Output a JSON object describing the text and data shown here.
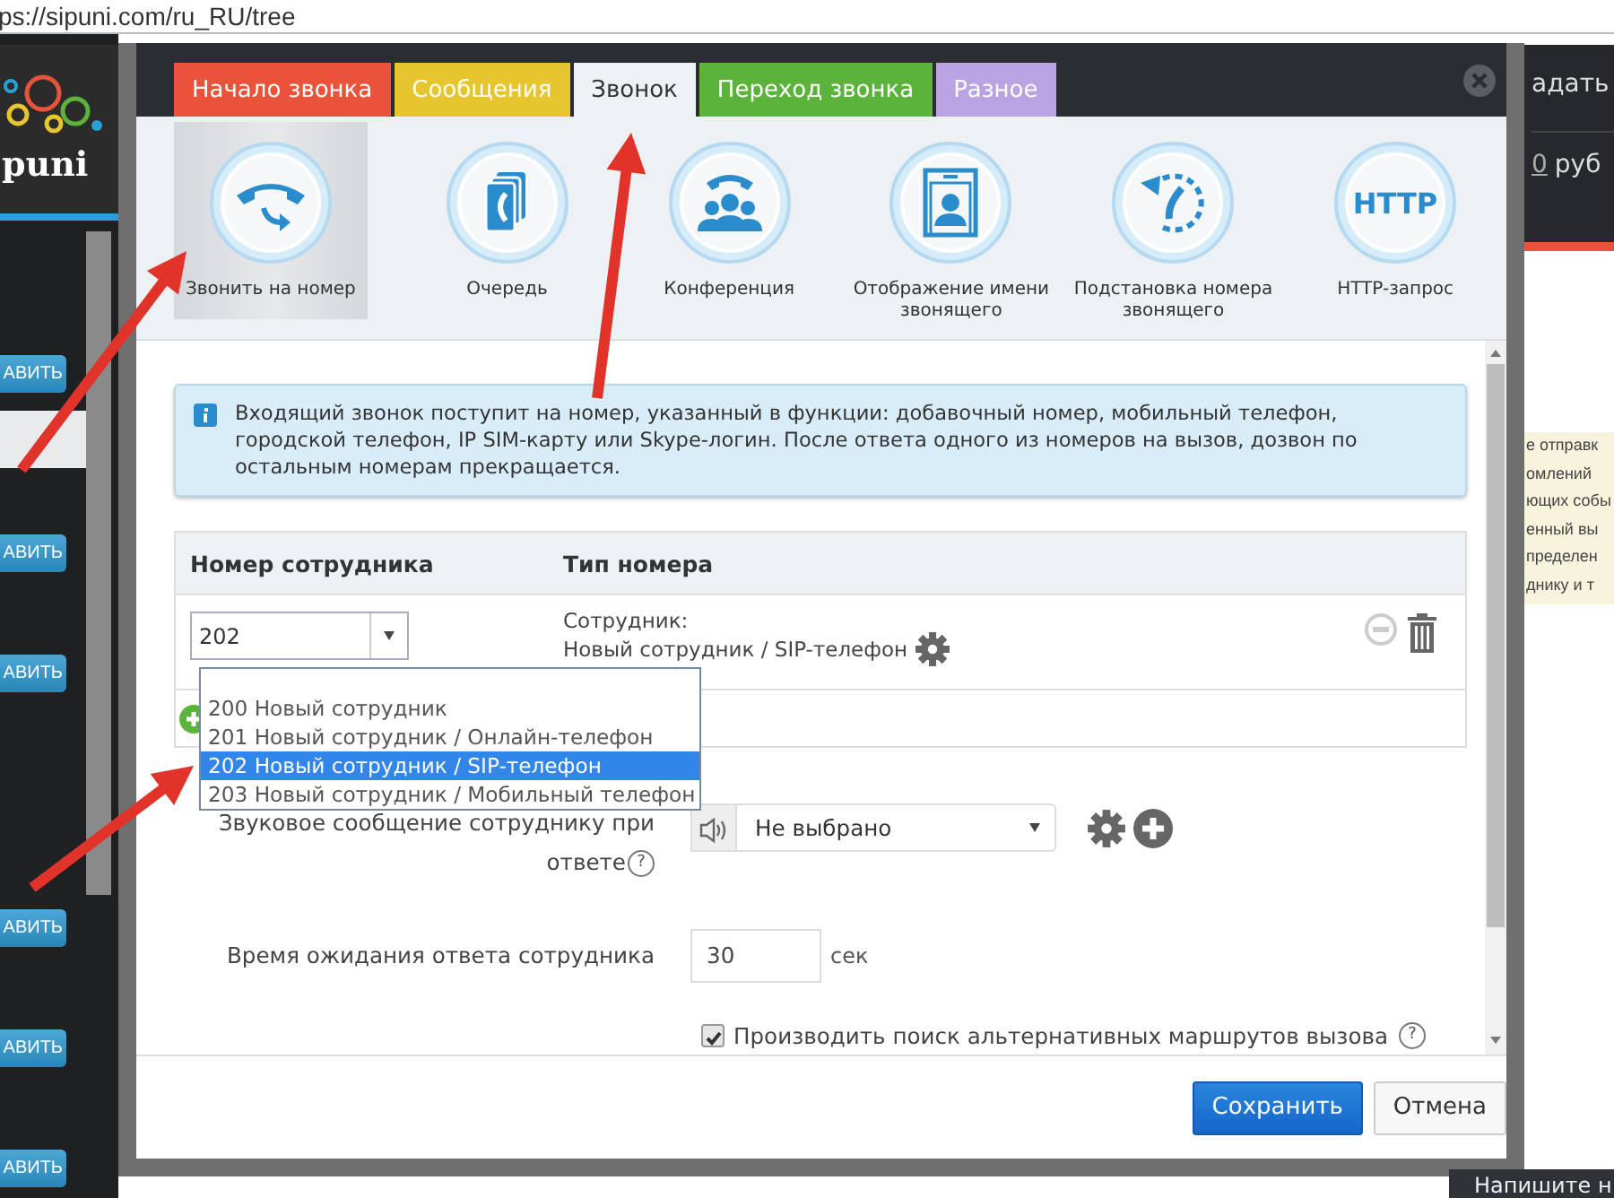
{
  "address_bar": {
    "url": "ps://sipuni.com/ru_RU/tree"
  },
  "background": {
    "logo": "puni",
    "sidebar_buttons": [
      "АВИТЬ",
      "АВИТЬ",
      "АВИТЬ",
      "АВИТЬ",
      "АВИТЬ",
      "АВИТЬ"
    ],
    "header_link": "адать",
    "balance_value": "0",
    "balance_unit": "руб",
    "note_lines": [
      "е отправк",
      "омлений",
      "ющих собы",
      "енный вы",
      "пределен",
      "днику и т"
    ],
    "chat_tooltip": "Напишите н"
  },
  "dialog": {
    "tabs": [
      {
        "label": "Начало звонка",
        "color": "#e8533a",
        "selected": false
      },
      {
        "label": "Сообщения",
        "color": "#e6c52e",
        "selected": false
      },
      {
        "label": "Звонок",
        "color": "#eef1f4",
        "selected": true
      },
      {
        "label": "Переход звонка",
        "color": "#5bb33b",
        "selected": false
      },
      {
        "label": "Разное",
        "color": "#b9a3e3",
        "selected": false
      }
    ],
    "functions": [
      {
        "kind": "call",
        "label": "Звонить на номер",
        "selected": true
      },
      {
        "kind": "queue",
        "label": "Очередь",
        "selected": false
      },
      {
        "kind": "conference",
        "label": "Конференция",
        "selected": false
      },
      {
        "kind": "caller-id",
        "label": "Отображение имени звонящего",
        "selected": false
      },
      {
        "kind": "replace",
        "label": "Подстановка номера звонящего",
        "selected": false
      },
      {
        "kind": "http",
        "icon_text": "HTTP",
        "label": "HTTP-запрос",
        "selected": false
      }
    ],
    "info": "Входящий звонок поступит на номер, указанный в функции: добавочный номер, мобильный телефон, городской телефон, IP SIM-карту или Skype-логин. После ответа одного из номеров на вызов, дозвон по остальным номерам прекращается.",
    "table": {
      "columns": [
        "Номер сотрудника",
        "Тип номера"
      ],
      "rows": [
        {
          "number": "202",
          "type_label": "Сотрудник:",
          "type_value": "Новый сотрудник / SIP-телефон"
        }
      ]
    },
    "dropdown": {
      "options": [
        {
          "label": "200 Новый сотрудник",
          "selected": false
        },
        {
          "label": "201 Новый сотрудник / Онлайн-телефон",
          "selected": false
        },
        {
          "label": "202 Новый сотрудник / SIP-телефон",
          "selected": true
        },
        {
          "label": "203 Новый сотрудник / Мобильный телефон",
          "selected": false
        }
      ]
    },
    "sound_field": {
      "label": "Звуковое сообщение сотруднику при ответе",
      "help": "?",
      "value": "Не выбрано"
    },
    "timeout_field": {
      "label": "Время ожидания ответа сотрудника",
      "value": "30",
      "unit": "сек"
    },
    "alt_routes": {
      "label": "Производить поиск альтернативных маршрутов вызова",
      "help": "?",
      "checked": true
    },
    "buttons": [
      {
        "kind": "primary",
        "label": "Сохранить"
      },
      {
        "kind": "default",
        "label": "Отмена"
      }
    ]
  }
}
